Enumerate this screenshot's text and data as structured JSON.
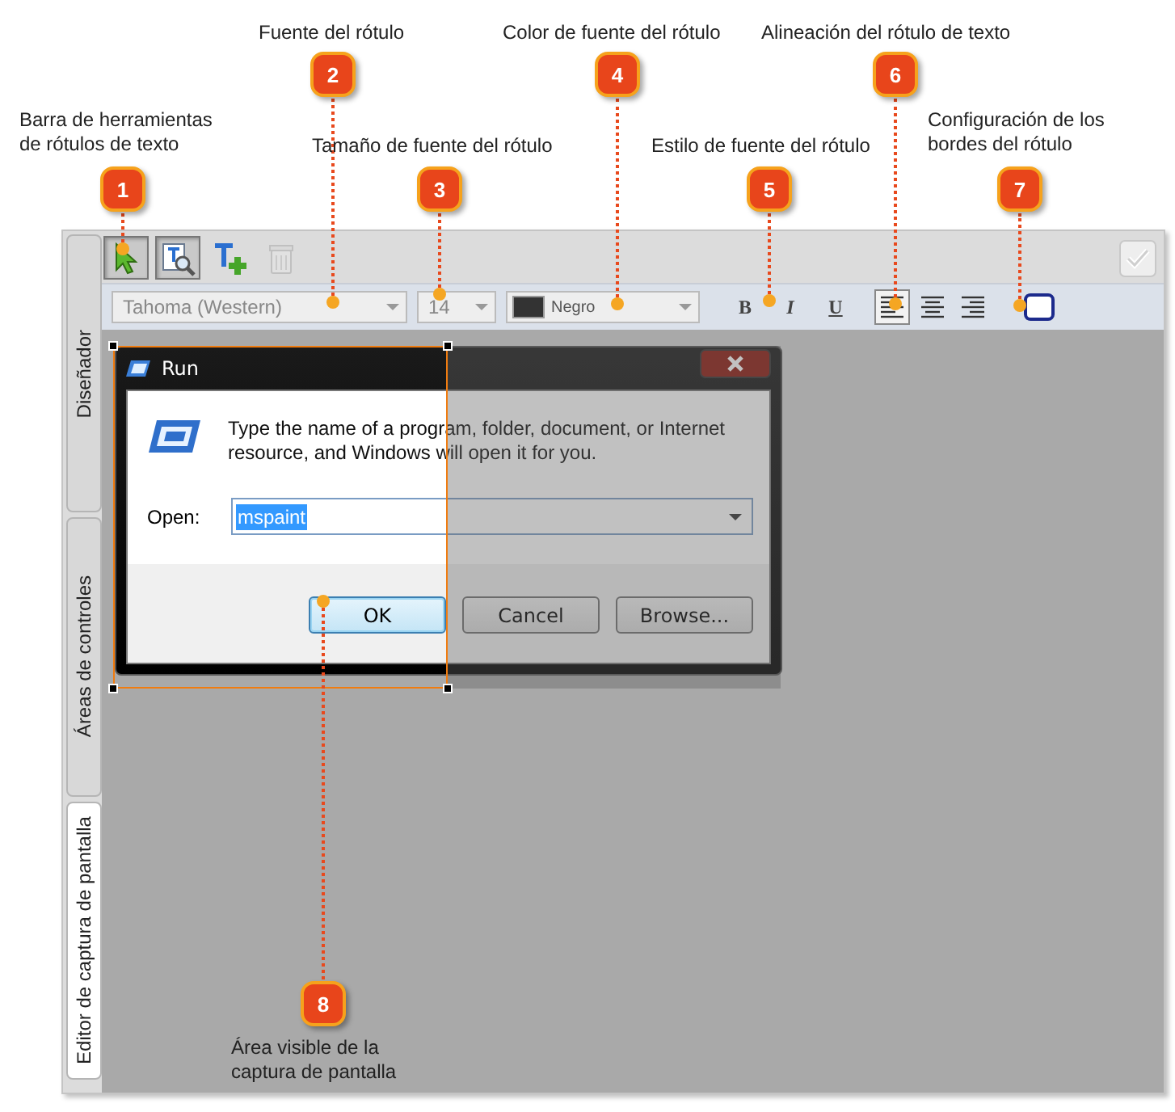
{
  "callouts": [
    {
      "number": "1",
      "label": "Barra de herramientas de rótulos de texto"
    },
    {
      "number": "2",
      "label": "Fuente del rótulo"
    },
    {
      "number": "3",
      "label": "Tamaño de fuente del rótulo"
    },
    {
      "number": "4",
      "label": "Color de fuente del rótulo"
    },
    {
      "number": "5",
      "label": "Estilo de fuente del rótulo"
    },
    {
      "number": "6",
      "label": "Alineación del rótulo de texto"
    },
    {
      "number": "7",
      "label": "Configuración de los bordes del rótulo"
    },
    {
      "number": "8",
      "label": "Área visible de la captura de pantalla"
    }
  ],
  "side_tabs": [
    {
      "label": "Diseñador",
      "selected": false
    },
    {
      "label": "Áreas de controles",
      "selected": false
    },
    {
      "label": "Editor de captura de pantalla",
      "selected": true
    }
  ],
  "tools": [
    {
      "kind": "pointer",
      "selected": true,
      "disabled": false
    },
    {
      "kind": "zoom",
      "selected": true,
      "disabled": false
    },
    {
      "kind": "add",
      "selected": false,
      "disabled": false
    },
    {
      "kind": "delete",
      "selected": false,
      "disabled": true
    }
  ],
  "format_bar": {
    "font": "Tahoma (Western)",
    "size": "14",
    "color_name": "Negro",
    "color": "#333333",
    "styles": [
      {
        "kind": "bold",
        "label": "B"
      },
      {
        "kind": "italic",
        "label": "I"
      },
      {
        "kind": "underline",
        "label": "U"
      }
    ],
    "align": [
      {
        "kind": "left",
        "selected": true
      },
      {
        "kind": "center",
        "selected": false
      },
      {
        "kind": "right",
        "selected": false
      }
    ]
  },
  "run_dialog": {
    "title": "Run",
    "message": "Type the name of a program, folder, document, or Internet resource, and Windows will open it for you.",
    "open_label": "Open:",
    "value": "mspaint",
    "buttons": [
      {
        "label": "OK",
        "selected": true
      },
      {
        "label": "Cancel",
        "selected": false
      },
      {
        "label": "Browse...",
        "selected": false
      }
    ]
  }
}
